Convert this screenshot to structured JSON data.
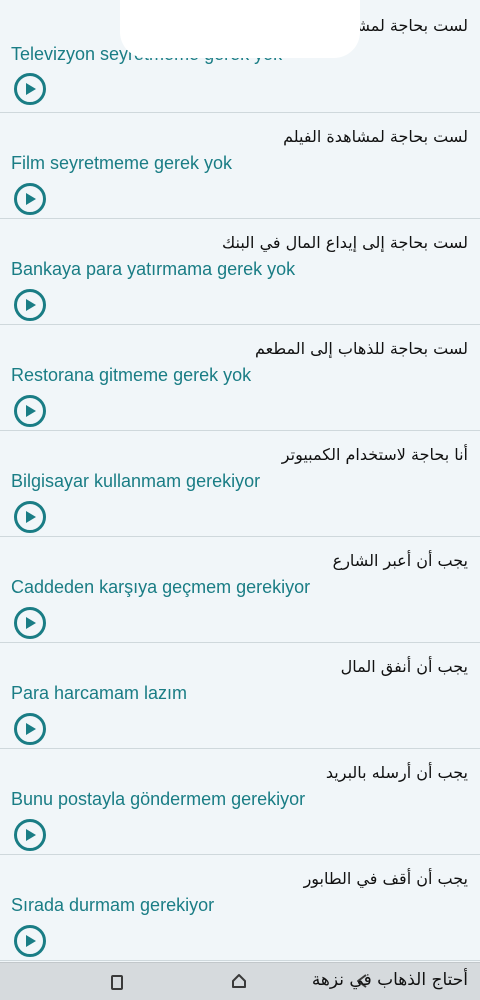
{
  "phrases": [
    {
      "arabic": "لست بحاجة لمشاهدة التلفاز",
      "turkish": "Televizyon seyretmeme gerek yok"
    },
    {
      "arabic": "لست بحاجة لمشاهدة الفيلم",
      "turkish": "Film seyretmeme gerek yok"
    },
    {
      "arabic": "لست بحاجة إلى إيداع المال في البنك",
      "turkish": "Bankaya para yatırmama gerek yok"
    },
    {
      "arabic": "لست بحاجة للذهاب إلى المطعم",
      "turkish": "Restorana gitmeme gerek yok"
    },
    {
      "arabic": "أنا بحاجة لاستخدام الكمبيوتر",
      "turkish": "Bilgisayar kullanmam gerekiyor"
    },
    {
      "arabic": "يجب أن أعبر الشارع",
      "turkish": "Caddeden karşıya geçmem gerekiyor"
    },
    {
      "arabic": "يجب أن أنفق المال",
      "turkish": "Para harcamam lazım"
    },
    {
      "arabic": "يجب أن أرسله بالبريد",
      "turkish": "Bunu postayla göndermem gerekiyor"
    },
    {
      "arabic": "يجب أن أقف في الطابور",
      "turkish": "Sırada durmam gerekiyor"
    }
  ],
  "icons": {
    "play": "play-icon",
    "recent": "recent-apps-icon",
    "home": "home-icon",
    "back": "back-icon"
  },
  "colors": {
    "accent": "#1a7d85",
    "background": "#f1f6f9",
    "divider": "#cfd8dc",
    "nav_bar": "#d6dadd"
  },
  "nav": {
    "title": "أحتاج الذهاب في نزهة"
  }
}
